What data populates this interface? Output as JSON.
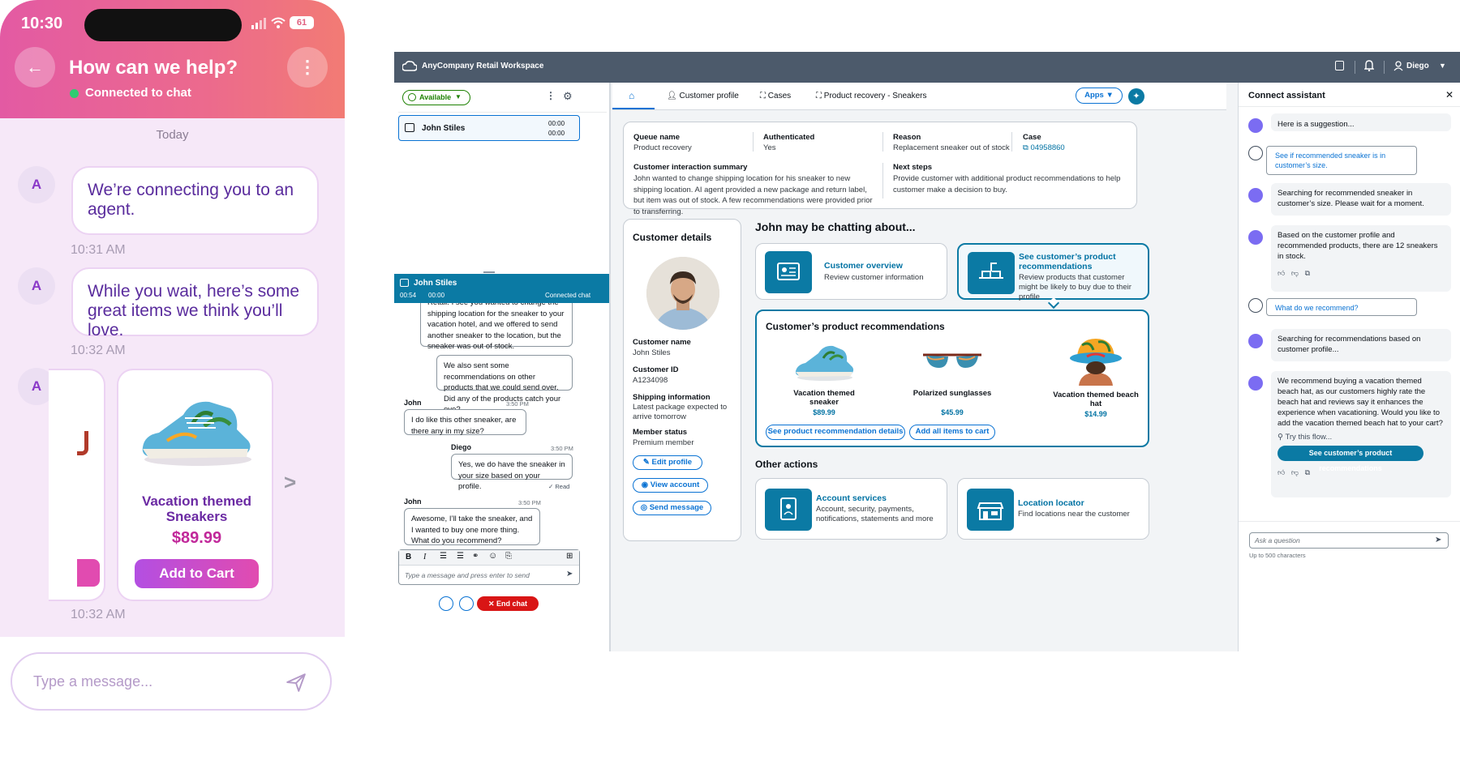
{
  "phone": {
    "time": "10:30",
    "battery": "61",
    "title": "How can we help?",
    "status": "Connected to chat",
    "date_divider": "Today",
    "avatar_letter": "A",
    "messages": [
      {
        "text": "We’re connecting you to an agent.",
        "time": "10:31 AM"
      },
      {
        "text": "While you wait, here’s some great items we think you’ll love.",
        "time": "10:32 AM"
      }
    ],
    "product": {
      "name": "Vacation themed Sneakers",
      "price": "$89.99",
      "button": "Add to Cart"
    },
    "product_time": "10:32 AM",
    "carousel_next": ">",
    "input_placeholder": "Type a message..."
  },
  "workspace": {
    "app_title": "AnyCompany Retail Workspace",
    "user": "Diego",
    "agent_status": "Available",
    "contact": {
      "name": "John Stiles",
      "timer1": "00:00",
      "timer2": "00:00"
    },
    "chat": {
      "name": "John Stiles",
      "timer1": "00:54",
      "timer2": "00:00",
      "status": "Connected chat",
      "messages": [
        {
          "sender": "",
          "time": "",
          "text": "Retail. I see you wanted to change the shipping location for the sneaker to your vacation hotel, and we offered to send another sneaker to the location, but the sneaker was out of stock."
        },
        {
          "sender": "",
          "time": "",
          "text": "We also sent some recommendations on other products that we could send over. Did any of the products catch your eye?"
        },
        {
          "sender": "John",
          "time": "3:50 PM",
          "text": "I do like this other sneaker, are there any in my size?"
        },
        {
          "sender": "Diego",
          "time": "3:50 PM",
          "text": "Yes, we do have the sneaker in your size based on your profile."
        },
        {
          "sender": "John",
          "time": "3:50 PM",
          "text": "Awesome, I’ll take the sneaker, and I wanted to buy one more thing. What do you recommend?"
        }
      ],
      "read": "Read",
      "input_placeholder": "Type a message and press enter to send",
      "end_chat": "End chat"
    },
    "tabs": [
      "Customer profile",
      "Cases",
      "Product recovery - Sneakers"
    ],
    "apps_label": "Apps",
    "summary": {
      "queue_label": "Queue name",
      "queue": "Product recovery",
      "auth_label": "Authenticated",
      "auth": "Yes",
      "reason_label": "Reason",
      "reason": "Replacement sneaker out of stock",
      "case_label": "Case",
      "case": "04958860",
      "cis_label": "Customer interaction summary",
      "cis": "John wanted to change shipping location for his sneaker to new  shipping location. AI agent provided a new package and return label, but item was out of stock. A few recommendations were provided prior to transferring.",
      "next_label": "Next steps",
      "next": "Provide customer with additional product recommendations to help customer make a decision to buy."
    },
    "customer": {
      "heading": "Customer details",
      "name_label": "Customer name",
      "name": "John Stiles",
      "id_label": "Customer ID",
      "id": "A1234098",
      "ship_label": "Shipping information",
      "ship": "Latest package expected to arrive tomorrow",
      "member_label": "Member status",
      "member": "Premium member",
      "edit": "Edit profile",
      "view": "View account",
      "send": "Send message"
    },
    "chatting_heading": "John may be chatting about...",
    "overview": {
      "title": "Customer overview",
      "desc": "Review customer information"
    },
    "recs_card": {
      "title": "See customer’s product recommendations",
      "desc": "Review products that customer might be likely to buy due to their profile"
    },
    "recs": {
      "heading": "Customer’s product recommendations",
      "items": [
        {
          "name": "Vacation themed sneaker",
          "price": "$89.99"
        },
        {
          "name": "Polarized sunglasses",
          "price": "$45.99"
        },
        {
          "name": "Vacation themed beach hat",
          "price": "$14.99"
        }
      ],
      "details_btn": "See product recommendation details",
      "cart_btn": "Add all items to cart"
    },
    "other_heading": "Other actions",
    "account": {
      "title": "Account services",
      "desc": "Account, security, payments, notifications, statements and more"
    },
    "locator": {
      "title": "Location locator",
      "desc": "Find locations near the customer"
    }
  },
  "assistant": {
    "title": "Connect assistant",
    "msgs": [
      "Here is a suggestion...",
      "See if recommended sneaker is in customer’s size.",
      "Searching for recommended sneaker in customer’s size. Please wait for a moment.",
      "Based on the customer profile and recommended products, there are 12 sneakers in stock.",
      "What do we recommend?",
      "Searching for recommendations based on customer profile...",
      "We recommend buying a vacation themed beach hat, as our customers highly rate the beach hat and reviews say it enhances the experience when vacationing. Would you like to add the vacation themed beach hat to your cart?"
    ],
    "try_flow": "Try this flow...",
    "flow_button": "See customer’s product recommendations",
    "input_placeholder": "Ask a question",
    "hint": "Up to 500 characters"
  },
  "colors": {
    "accent": "#0972d3",
    "teal": "#0b7aa4",
    "end_chat": "#d91515",
    "phone_header": "#e35aa3",
    "phone_button": "#c24fe0"
  }
}
